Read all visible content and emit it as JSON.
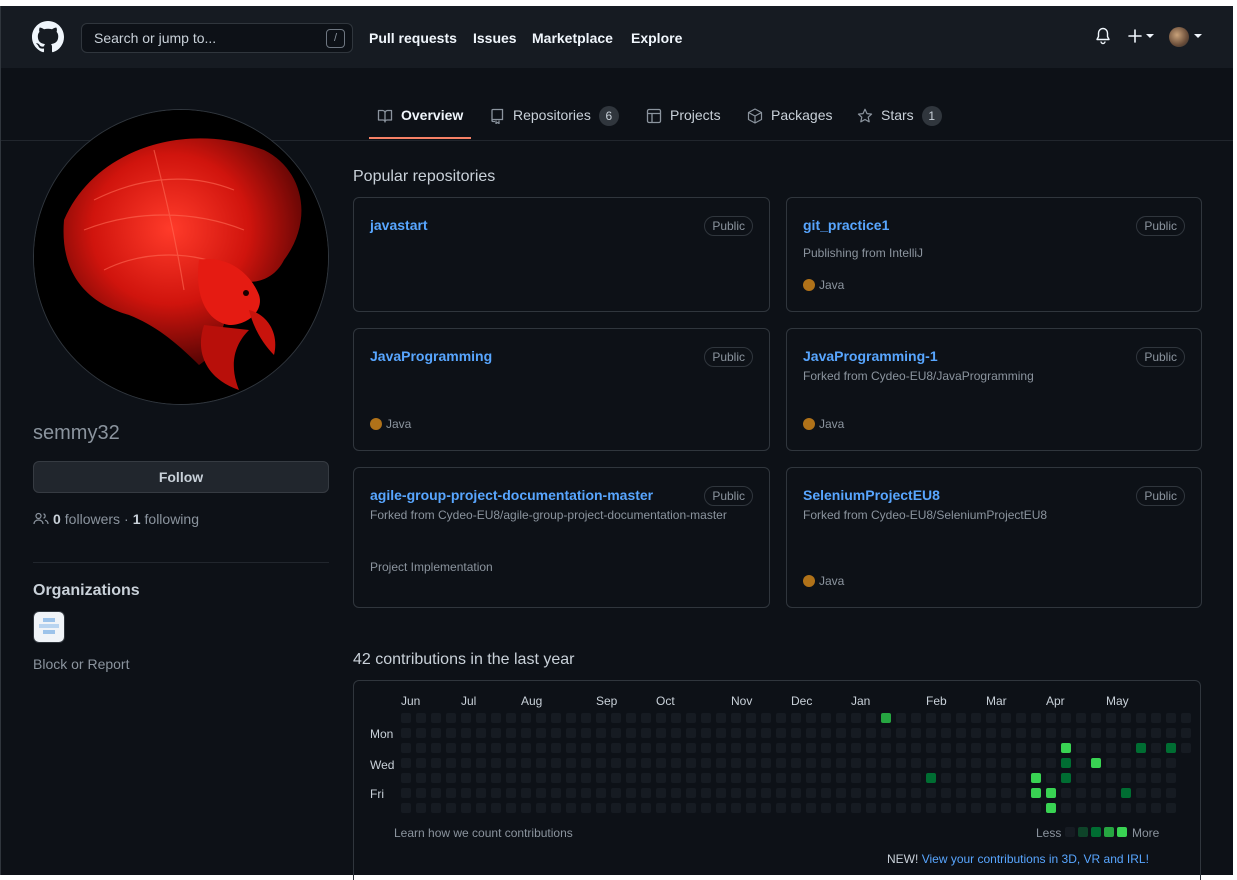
{
  "header": {
    "search_placeholder": "Search or jump to...",
    "search_shortcut": "/",
    "nav": [
      "Pull requests",
      "Issues",
      "Marketplace",
      "Explore"
    ],
    "plus_label": "+"
  },
  "tabs": {
    "overview": "Overview",
    "repositories": "Repositories",
    "repositories_count": "6",
    "projects": "Projects",
    "packages": "Packages",
    "stars": "Stars",
    "stars_count": "1"
  },
  "profile": {
    "username": "semmy32",
    "follow_label": "Follow",
    "followers_count": "0",
    "followers_label": "followers",
    "separator": "·",
    "following_count": "1",
    "following_label": "following",
    "organizations_title": "Organizations",
    "block_report": "Block or Report"
  },
  "popular": {
    "title": "Popular repositories",
    "repos": [
      {
        "name": "javastart",
        "visibility": "Public",
        "desc": "",
        "extra": "",
        "language": ""
      },
      {
        "name": "git_practice1",
        "visibility": "Public",
        "desc": "Publishing from IntelliJ",
        "extra": "",
        "language": "Java"
      },
      {
        "name": "JavaProgramming",
        "visibility": "Public",
        "desc": "",
        "extra": "",
        "language": "Java"
      },
      {
        "name": "JavaProgramming-1",
        "visibility": "Public",
        "desc": "Forked from Cydeo-EU8/JavaProgramming",
        "extra": "",
        "language": "Java"
      },
      {
        "name": "agile-group-project-documentation-master",
        "visibility": "Public",
        "desc": "Forked from Cydeo-EU8/agile-group-project-documentation-master",
        "extra": "Project Implementation",
        "language": ""
      },
      {
        "name": "SeleniumProjectEU8",
        "visibility": "Public",
        "desc": "Forked from Cydeo-EU8/SeleniumProjectEU8",
        "extra": "",
        "language": "Java"
      }
    ],
    "language_color": "#b07219"
  },
  "contributions": {
    "title": "42 contributions in the last year",
    "months": [
      "Jun",
      "Jul",
      "Aug",
      "Sep",
      "Oct",
      "Nov",
      "Dec",
      "Jan",
      "Feb",
      "Mar",
      "Apr",
      "May"
    ],
    "days": [
      "Mon",
      "Wed",
      "Fri"
    ],
    "learn": "Learn how we count contributions",
    "less": "Less",
    "more": "More",
    "new_prefix": "NEW!",
    "new_link": "View your contributions in 3D, VR and IRL!",
    "colors": [
      "#161b22",
      "#0e4429",
      "#006d32",
      "#26a641",
      "#39d353"
    ],
    "active_cells": [
      {
        "week": 32,
        "day": 0,
        "level": 3
      },
      {
        "week": 35,
        "day": 4,
        "level": 2
      },
      {
        "week": 42,
        "day": 4,
        "level": 4
      },
      {
        "week": 42,
        "day": 5,
        "level": 4
      },
      {
        "week": 43,
        "day": 5,
        "level": 4
      },
      {
        "week": 43,
        "day": 6,
        "level": 4
      },
      {
        "week": 44,
        "day": 2,
        "level": 4
      },
      {
        "week": 44,
        "day": 3,
        "level": 2
      },
      {
        "week": 44,
        "day": 4,
        "level": 2
      },
      {
        "week": 46,
        "day": 3,
        "level": 4
      },
      {
        "week": 48,
        "day": 5,
        "level": 2
      },
      {
        "week": 49,
        "day": 2,
        "level": 2
      },
      {
        "week": 51,
        "day": 2,
        "level": 2
      }
    ]
  }
}
